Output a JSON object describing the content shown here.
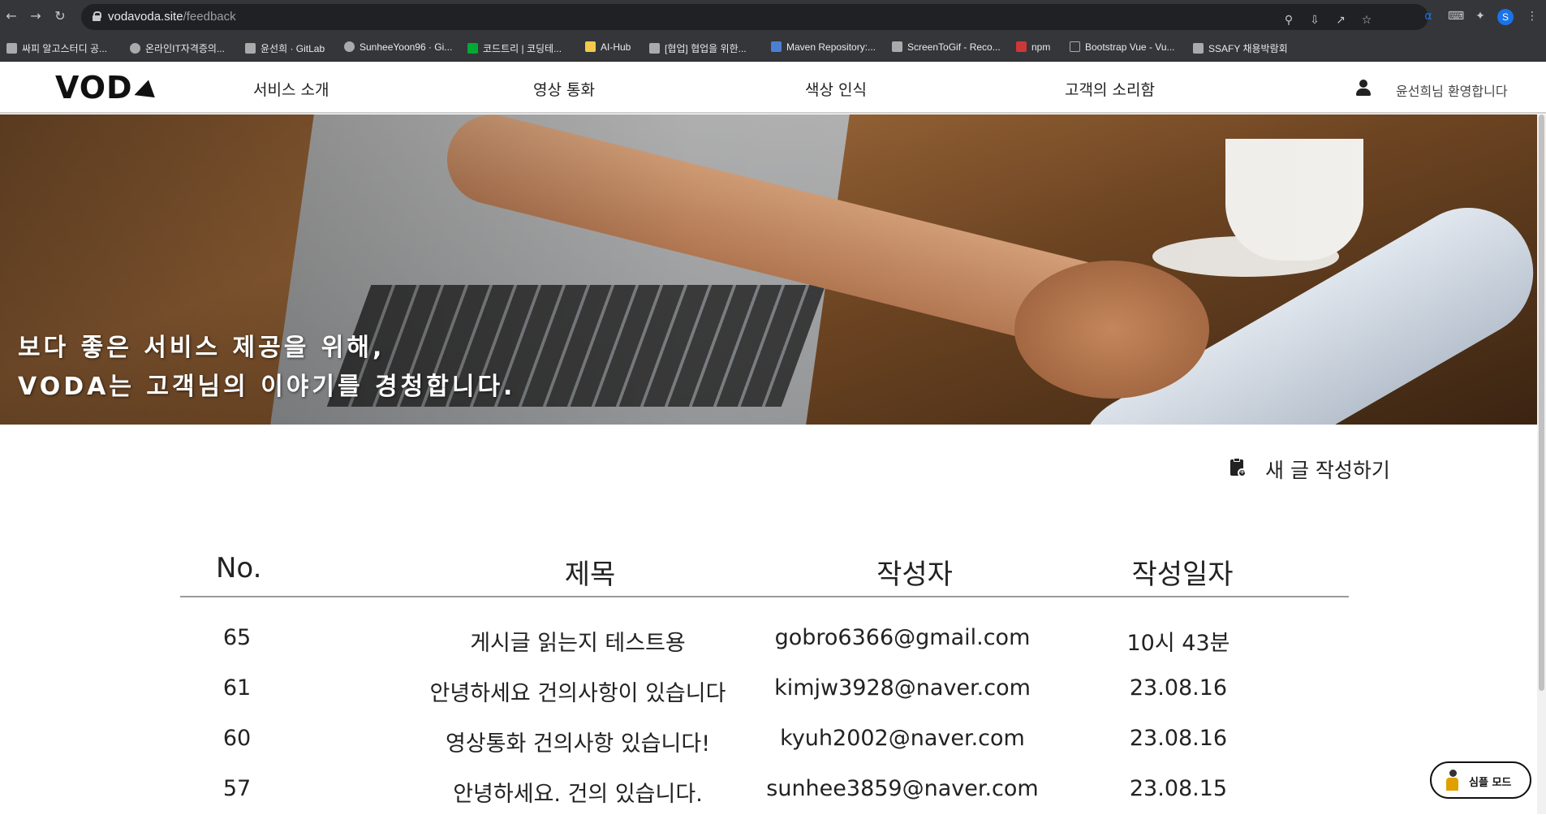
{
  "browser": {
    "url_host": "vodavoda.site",
    "url_path": "/feedback",
    "profile_initial": "S",
    "bookmarks": [
      {
        "label": "싸피 알고스터디 공..."
      },
      {
        "label": "온라인IT자격증의..."
      },
      {
        "label": "윤선희 · GitLab"
      },
      {
        "label": "SunheeYoon96 · Gi..."
      },
      {
        "label": "코드트리 | 코딩테..."
      },
      {
        "label": "AI-Hub"
      },
      {
        "label": "[협업] 협업을 위한..."
      },
      {
        "label": "Maven Repository:..."
      },
      {
        "label": "ScreenToGif - Reco..."
      },
      {
        "label": "npm"
      },
      {
        "label": "Bootstrap Vue - Vu..."
      },
      {
        "label": "SSAFY 채용박람회"
      }
    ]
  },
  "header": {
    "logo": "VOD",
    "menu": [
      {
        "label": "서비스 소개"
      },
      {
        "label": "영상 통화"
      },
      {
        "label": "색상 인식"
      },
      {
        "label": "고객의 소리함"
      }
    ],
    "welcome": "윤선희님 환영합니다"
  },
  "hero": {
    "line1": "보다 좋은 서비스 제공을 위해,",
    "line2": "VODA는 고객님의 이야기를 경청합니다."
  },
  "actions": {
    "write_label": "새 글 작성하기"
  },
  "table": {
    "headers": [
      "No.",
      "제목",
      "작성자",
      "작성일자"
    ],
    "rows": [
      {
        "no": "65",
        "title": "게시글 읽는지 테스트용",
        "author": "gobro6366@gmail.com",
        "date": "10시 43분"
      },
      {
        "no": "61",
        "title": "안녕하세요 건의사항이 있습니다",
        "author": "kimjw3928@naver.com",
        "date": "23.08.16"
      },
      {
        "no": "60",
        "title": "영상통화 건의사항 있습니다!",
        "author": "kyuh2002@naver.com",
        "date": "23.08.16"
      },
      {
        "no": "57",
        "title": "안녕하세요. 건의 있습니다.",
        "author": "sunhee3859@naver.com",
        "date": "23.08.15"
      }
    ]
  },
  "simple_mode": {
    "label": "심플 모드"
  }
}
